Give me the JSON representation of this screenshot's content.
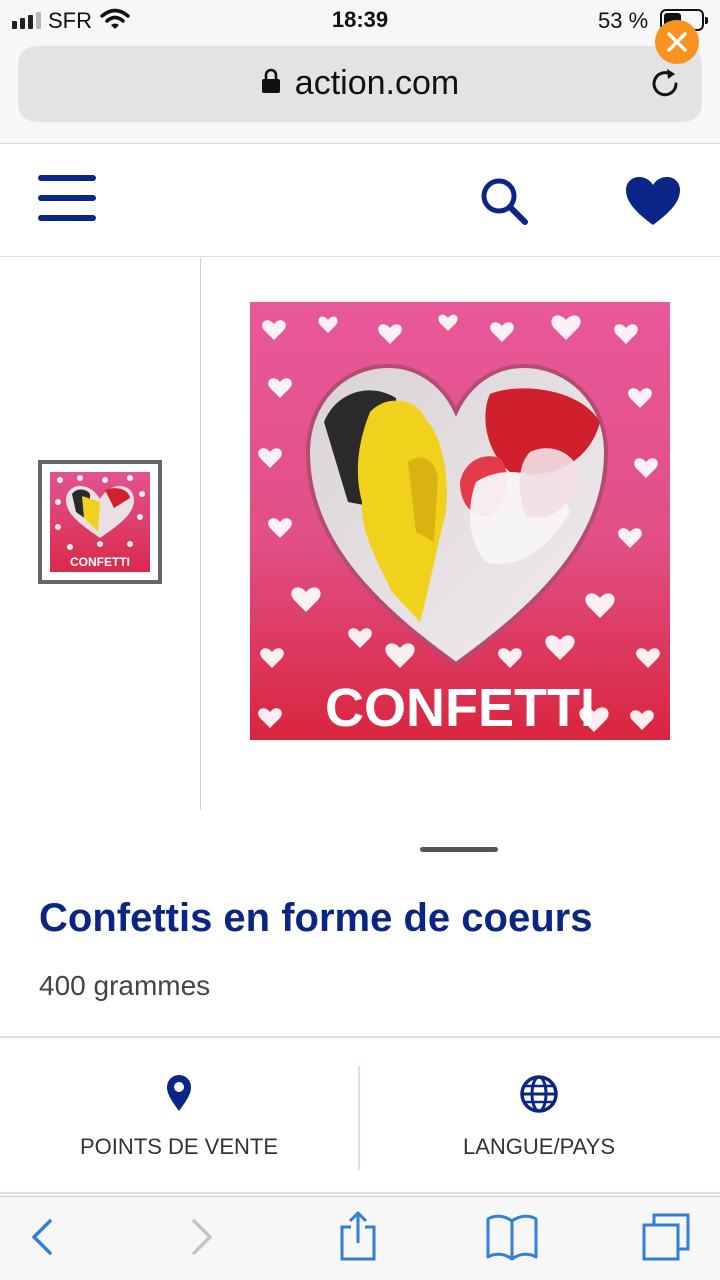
{
  "status_bar": {
    "carrier": "SFR",
    "time": "18:39",
    "battery_percent": "53 %",
    "battery_level": 0.53
  },
  "browser": {
    "url": "action.com"
  },
  "product": {
    "title": "Confettis en forme de coeurs",
    "weight": "400 grammes",
    "image_label": "CONFETTI",
    "thumb_label": "CONFETTI"
  },
  "footer_links": [
    {
      "label": "POINTS DE VENTE",
      "icon": "location-pin-icon"
    },
    {
      "label": "LANGUE/PAYS",
      "icon": "globe-icon"
    }
  ],
  "toolbar": {
    "back_icon": "chevron-left-icon",
    "forward_icon": "chevron-right-icon",
    "share_icon": "share-icon",
    "bookmarks_icon": "book-icon",
    "tabs_icon": "tabs-icon"
  },
  "colors": {
    "brand_blue": "#0a2585",
    "accent_orange": "#f7931e",
    "link_blue": "#2f7ed8"
  }
}
